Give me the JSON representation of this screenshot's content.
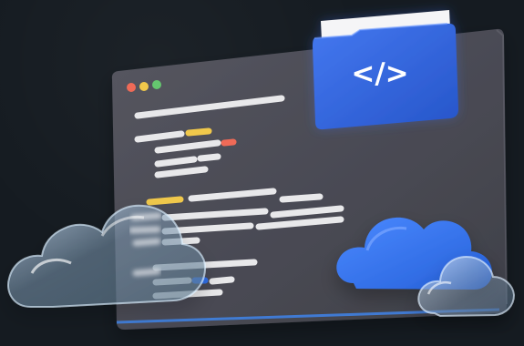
{
  "illustration": {
    "folder_symbol": "</>",
    "icons": [
      "code-window-illustration",
      "folder-code-icon",
      "cloud-icon"
    ],
    "colors": {
      "background": "#151b21",
      "window": "#4c4c56",
      "folder": "#2f63db",
      "cloud_blue": "#2f6ee8",
      "code_line": "#e8e8ea",
      "accent_yellow": "#f0c84b",
      "accent_red": "#ef6a57",
      "accent_green": "#65c76f"
    }
  }
}
